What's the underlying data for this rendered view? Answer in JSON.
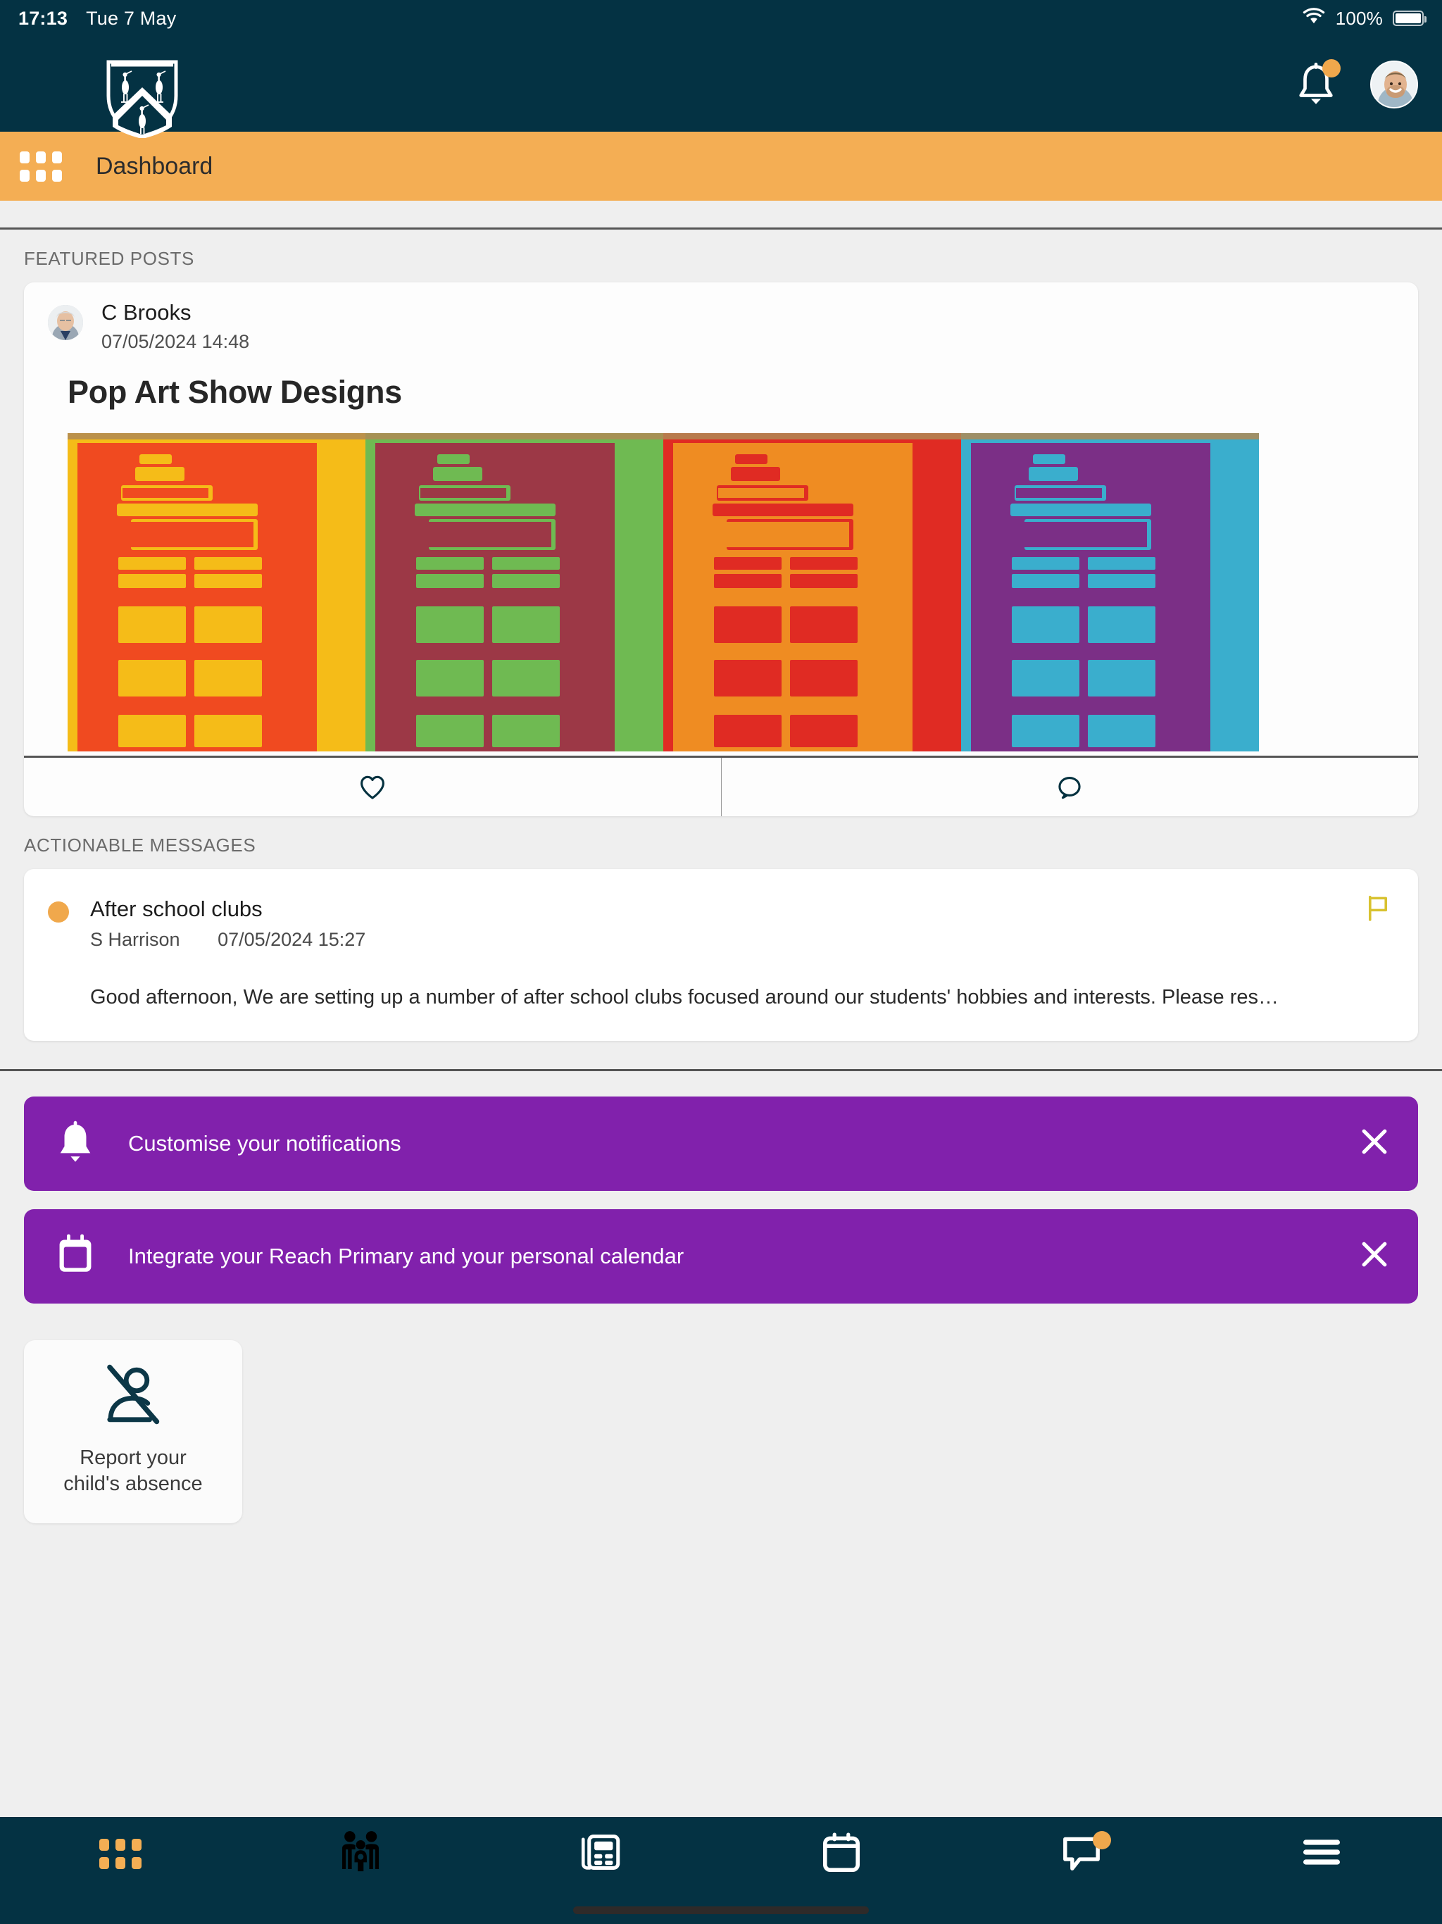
{
  "status_bar": {
    "time": "17:13",
    "date": "Tue 7 May",
    "battery_percent": "100%",
    "wifi_icon": "wifi-icon",
    "battery_icon": "battery-icon"
  },
  "header": {
    "logo_icon": "school-crest-icon",
    "notifications_icon": "bell-icon",
    "notifications_badge": true,
    "avatar_icon": "user-avatar"
  },
  "subbar": {
    "menu_icon": "grid-icon",
    "title": "Dashboard"
  },
  "sections": {
    "featured_posts_label": "FEATURED POSTS",
    "actionable_messages_label": "ACTIONABLE MESSAGES"
  },
  "featured_post": {
    "author": "C Brooks",
    "timestamp": "07/05/2024 14:48",
    "title": "Pop Art Show Designs",
    "image_alt": "Pop art printed building designs in four colour panels",
    "like_icon": "heart-icon",
    "comment_icon": "comment-icon"
  },
  "actionable_message": {
    "unread_dot": true,
    "title": "After school clubs",
    "author": "S Harrison",
    "timestamp": "07/05/2024 15:27",
    "preview": "Good afternoon, We are setting up a number of after school clubs focused around our students' hobbies and interests. Please res…",
    "flag_icon": "flag-icon"
  },
  "banners": [
    {
      "icon": "bell-icon",
      "label": "Customise your notifications",
      "close_icon": "close-icon"
    },
    {
      "icon": "calendar-icon",
      "label": "Integrate your Reach Primary and your personal calendar",
      "close_icon": "close-icon"
    }
  ],
  "quick_tiles": [
    {
      "icon": "person-absent-icon",
      "label_line1": "Report your",
      "label_line2": "child's absence"
    }
  ],
  "bottom_nav": [
    {
      "icon": "grid-icon",
      "name": "dashboard",
      "active": true,
      "badge": false
    },
    {
      "icon": "family-icon",
      "name": "students",
      "active": false,
      "badge": false
    },
    {
      "icon": "newspaper-icon",
      "name": "news",
      "active": false,
      "badge": false
    },
    {
      "icon": "calendar-icon",
      "name": "calendar",
      "active": false,
      "badge": false
    },
    {
      "icon": "chat-icon",
      "name": "messages",
      "active": false,
      "badge": true
    },
    {
      "icon": "hamburger-icon",
      "name": "more",
      "active": false,
      "badge": false
    }
  ],
  "colors": {
    "header_dark": "#043243",
    "accent_orange": "#f4ae54",
    "badge_orange": "#f0a84c",
    "banner_purple": "#8121ac",
    "page_background": "#efefef",
    "flag_yellow": "#d8c230"
  },
  "artwork_panels": [
    {
      "background": "#f5bc18",
      "figure": "#f04a20"
    },
    {
      "background": "#6fba52",
      "figure": "#9c3846"
    },
    {
      "background": "#e02b23",
      "figure": "#ef8c22"
    },
    {
      "background": "#3aaecd",
      "figure": "#7b2f86"
    }
  ]
}
